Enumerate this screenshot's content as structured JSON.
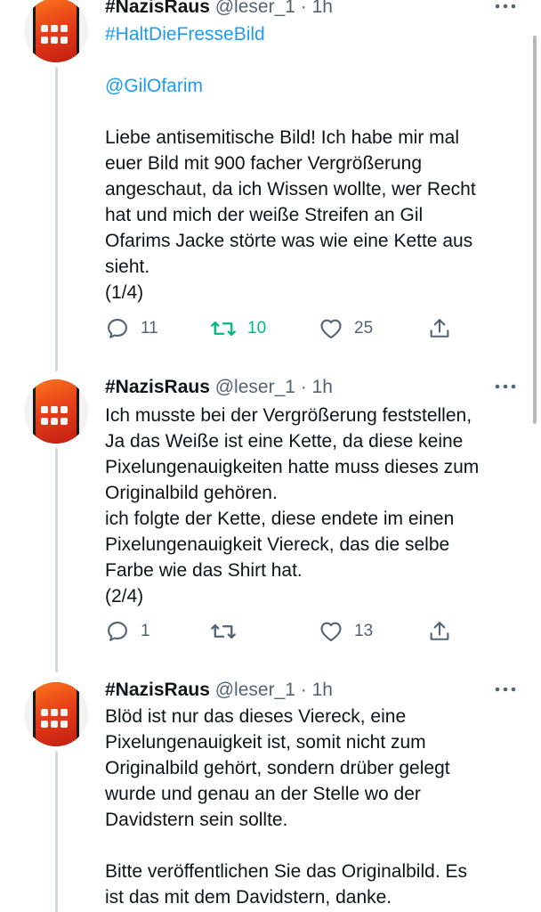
{
  "tweets": [
    {
      "name": "#NazisRaus",
      "handle": "@leser_1",
      "time": "1h",
      "hashtag": "#HaltDieFresseBild",
      "mention": "@GilOfarim",
      "lines": [
        "Liebe antisemitische Bild! Ich habe mir mal",
        "euer Bild mit 900 facher Vergrößerung",
        "angeschaut, da ich Wissen wollte, wer Recht",
        "hat und mich der weiße Streifen an Gil",
        "Ofarims Jacke störte was wie eine Kette aus",
        "sieht.",
        "(1/4)"
      ],
      "replies": "11",
      "retweets": "10",
      "likes": "25",
      "retweeted": true
    },
    {
      "name": "#NazisRaus",
      "handle": "@leser_1",
      "time": "1h",
      "lines": [
        "Ich musste bei der Vergrößerung feststellen,",
        "Ja das Weiße ist eine Kette, da diese keine",
        "Pixelungenauigkeiten hatte muss dieses zum",
        "Originalbild gehören.",
        "ich folgte der Kette, diese endete im einen",
        "Pixelungenauigkeit Viereck, das die selbe",
        "Farbe wie das Shirt hat.",
        "(2/4)"
      ],
      "replies": "1",
      "retweets": "",
      "likes": "13",
      "retweeted": false
    },
    {
      "name": "#NazisRaus",
      "handle": "@leser_1",
      "time": "1h",
      "lines": [
        "Blöd ist nur das dieses Viereck, eine",
        "Pixelungenauigkeit ist, somit nicht zum",
        "Originalbild gehört, sondern drüber gelegt",
        "wurde und genau an der Stelle wo der",
        "Davidstern sein sollte.",
        "",
        "Bitte veröffentlichen Sie das Originalbild. Es",
        "ist das mit dem Davidstern, danke."
      ]
    }
  ],
  "icons": {
    "reply": "reply-icon",
    "retweet": "retweet-icon",
    "like": "heart-icon",
    "share": "share-icon",
    "more": "more-icon"
  },
  "colors": {
    "link": "#1d9bf0",
    "retweet_active": "#00ba7c",
    "secondary": "#536471",
    "thread_line": "#cfd9de"
  }
}
